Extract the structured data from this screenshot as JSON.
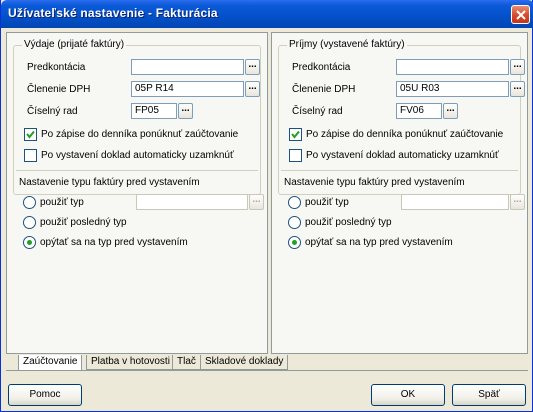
{
  "window": {
    "title": "Užívateľské nastavenie - Fakturácia"
  },
  "left": {
    "legend": "Výdaje (prijaté faktúry)",
    "predkontacia_label": "Predkontácia",
    "predkontacia_value": "",
    "dph_label": "Členenie DPH",
    "dph_value": "05P R14",
    "rad_label": "Číselný rad",
    "rad_value": "FP05",
    "browse": "...",
    "chk1_label": "Po zápise do denníka ponúknuť zaúčtovanie",
    "chk1_checked": true,
    "chk2_label": "Po vystavení doklad automaticky uzamknúť",
    "chk2_checked": false,
    "type_header": "Nastavenie typu faktúry pred vystavením",
    "radio1_label": "použiť typ",
    "radio2_label": "použiť posledný typ",
    "radio3_label": "opýtať sa na typ pred vystavením",
    "selected_radio": 3
  },
  "right": {
    "legend": "Príjmy (vystavené faktúry)",
    "predkontacia_label": "Predkontácia",
    "predkontacia_value": "",
    "dph_label": "Členenie DPH",
    "dph_value": "05U R03",
    "rad_label": "Číselný rad",
    "rad_value": "FV06",
    "browse": "...",
    "chk1_label": "Po zápise do denníka ponúknuť zaúčtovanie",
    "chk1_checked": true,
    "chk2_label": "Po vystavení doklad automaticky uzamknúť",
    "chk2_checked": false,
    "type_header": "Nastavenie typu faktúry pred vystavením",
    "radio1_label": "použiť typ",
    "radio2_label": "použiť posledný typ",
    "radio3_label": "opýtať sa na typ pred vystavením",
    "selected_radio": 3
  },
  "tabs": [
    {
      "label": "Zaúčtovanie",
      "active": true
    },
    {
      "label": "Platba v hotovosti",
      "active": false
    },
    {
      "label": "Tlač",
      "active": false
    },
    {
      "label": "Skladové doklady",
      "active": false
    }
  ],
  "buttons": {
    "help": "Pomoc",
    "ok": "OK",
    "back": "Späť"
  },
  "colors": {
    "title_bar": "#0450c9",
    "accent_check": "#21a121",
    "close": "#d6492a"
  }
}
